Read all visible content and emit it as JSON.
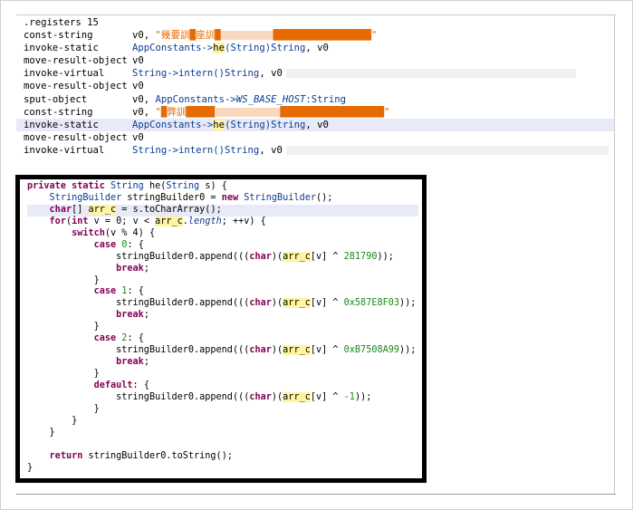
{
  "smali": {
    "registers_label": ".registers",
    "registers_count": "15",
    "lines": [
      {
        "op": "const-string",
        "reg": "v0, ",
        "str": "\"　要座██座　要████████████████████\""
      },
      {
        "op": "invoke-static",
        "cls": "AppConstants->",
        "mth": "he",
        "sig": "(String)String",
        "tail": ", v0"
      },
      {
        "op": "move-result-object",
        "reg": "v0"
      },
      {
        "op": "invoke-virtual",
        "cls": "String->intern()String",
        "tail": ", v0"
      },
      {
        "op": "move-result-object",
        "reg": "v0"
      },
      {
        "op": "sput-object",
        "reg": "v0, ",
        "cls": "AppConstants->",
        "field": "WS_BASE_HOST",
        "type": ":String"
      },
      {
        "op": "const-string",
        "reg": "v0, ",
        "str": "\"█████████████████████████████\""
      },
      {
        "op": "invoke-static",
        "cls": "AppConstants->",
        "mth": "he",
        "sig": "(String)String",
        "tail": ", v0"
      },
      {
        "op": "move-result-object",
        "reg": "v0"
      },
      {
        "op": "invoke-virtual",
        "cls": "String->intern()String",
        "tail": ", v0"
      }
    ]
  },
  "java": {
    "l1": {
      "a": "private static ",
      "b": "String",
      "c": " he(",
      "d": "String",
      "e": " s) {"
    },
    "l2": {
      "a": "    ",
      "b": "StringBuilder",
      "c": " stringBuilder0 = ",
      "d": "new",
      "e": " ",
      "f": "StringBuilder",
      "g": "();"
    },
    "l3": {
      "a": "    ",
      "b": "char",
      "c": "[] ",
      "d": "arr_c",
      "e": " = s.toCharArray();"
    },
    "l4": {
      "a": "    ",
      "b": "for",
      "c": "(",
      "d": "int",
      "e": " v = 0; v < ",
      "f": "arr_c",
      "g": ".",
      "h": "length",
      "i": "; ++v) {"
    },
    "l5": {
      "a": "        ",
      "b": "switch",
      "c": "(v % 4) {"
    },
    "cases": [
      {
        "label": "case",
        "num": "0",
        "hex": "281790"
      },
      {
        "label": "case",
        "num": "1",
        "hex": "0x587E8F03"
      },
      {
        "label": "case",
        "num": "2",
        "hex": "0xB7508A99"
      }
    ],
    "default_label": "default",
    "default_hex": "-1",
    "append_a": "stringBuilder0.append(((",
    "append_char": "char",
    "append_b": ")(",
    "append_var": "arr_c",
    "append_c": "[v] ^ ",
    "append_d": "));",
    "break_kw": "break",
    "return_kw": "return",
    "return_rest": " stringBuilder0.toString();"
  }
}
